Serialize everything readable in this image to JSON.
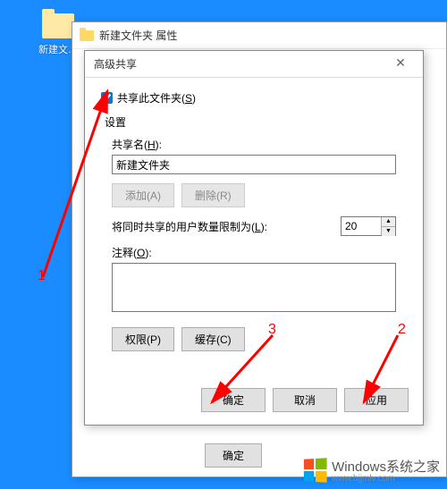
{
  "desktop": {
    "folder_label": "新建文…"
  },
  "properties": {
    "title": "新建文件夹 属性",
    "ok_label": "确定"
  },
  "advanced": {
    "title": "高级共享",
    "close_glyph": "✕",
    "share_checkbox_label": "共享此文件夹(",
    "share_checkbox_key": "S",
    "share_checkbox_suffix": ")",
    "share_checked": true,
    "settings_label": "设置",
    "share_name_label": "共享名(",
    "share_name_key": "H",
    "share_name_suffix": "):",
    "share_name_value": "新建文件夹",
    "add_label": "添加(A)",
    "remove_label": "删除(R)",
    "limit_label": "将同时共享的用户数量限制为(",
    "limit_key": "L",
    "limit_suffix": "):",
    "limit_value": "20",
    "comment_label": "注释(",
    "comment_key": "O",
    "comment_suffix": "):",
    "comment_value": "",
    "permissions_label": "权限(P)",
    "cache_label": "缓存(C)",
    "ok_label": "确定",
    "cancel_label": "取消",
    "apply_label": "应用"
  },
  "annotations": {
    "n1": "1",
    "n2": "2",
    "n3": "3"
  },
  "watermark": {
    "text": "Windows系统之家",
    "sub": "www.bjjmlv.com"
  }
}
